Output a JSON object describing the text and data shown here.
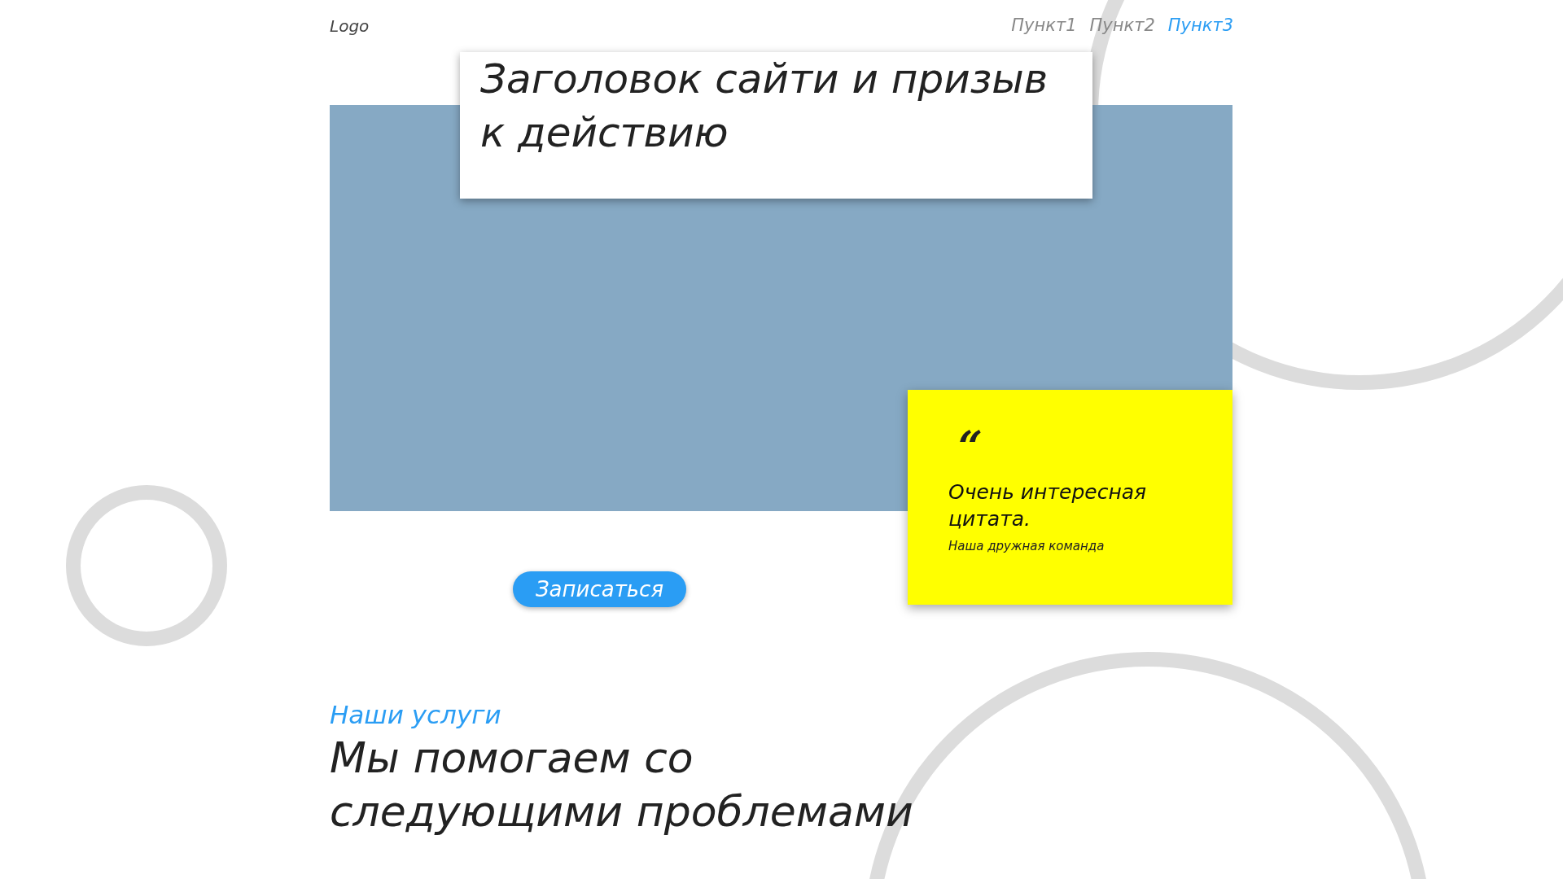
{
  "header": {
    "logo": "Logo",
    "nav": [
      {
        "label": "Пункт1",
        "selected": false
      },
      {
        "label": "Пункт2",
        "selected": false
      },
      {
        "label": "Пункт3",
        "selected": true
      }
    ]
  },
  "hero": {
    "title": "Заголовок сайти и призыв к действию",
    "button": "Записаться",
    "quote": {
      "mark": "“",
      "text": "Очень интересная цитата.",
      "author": "Наша дружная команда"
    }
  },
  "services": {
    "label": "Наши услуги",
    "heading": "Мы помогаем со следующими проблемами"
  }
}
